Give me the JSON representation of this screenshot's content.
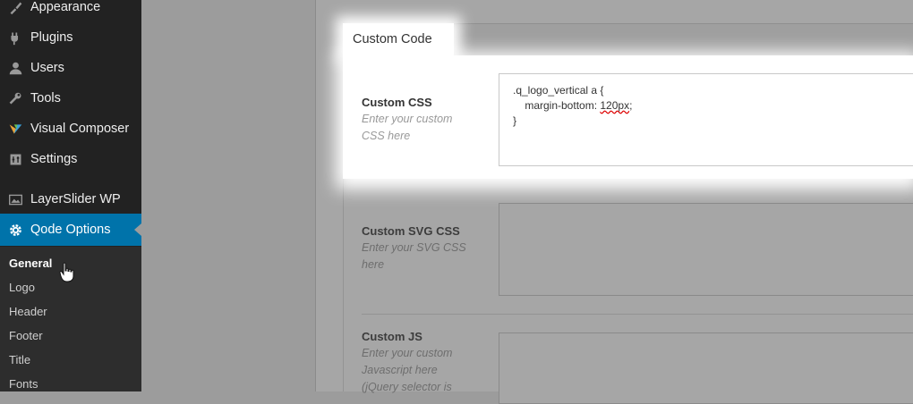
{
  "sidebar": {
    "items": [
      {
        "label": "Appearance",
        "icon": "brush-icon"
      },
      {
        "label": "Plugins",
        "icon": "plug-icon"
      },
      {
        "label": "Users",
        "icon": "user-icon"
      },
      {
        "label": "Tools",
        "icon": "wrench-icon"
      },
      {
        "label": "Visual Composer",
        "icon": "visual-composer-icon"
      },
      {
        "label": "Settings",
        "icon": "settings-icon"
      },
      {
        "label": "LayerSlider WP",
        "icon": "layerslider-icon"
      },
      {
        "label": "Qode Options",
        "icon": "gear-icon"
      }
    ],
    "submenu": [
      "General",
      "Logo",
      "Header",
      "Footer",
      "Title",
      "Fonts"
    ]
  },
  "section": {
    "tab_title": "Custom Code",
    "fields": [
      {
        "label": "Custom CSS",
        "description": "Enter your custom CSS here",
        "desc_lines": [
          "Enter your custom",
          "CSS here"
        ],
        "value_lines": [
          ".q_logo_vertical a {",
          "    margin-bottom: ",
          "120px",
          ";",
          "}"
        ]
      },
      {
        "label": "Custom SVG CSS",
        "description": "Enter your SVG CSS here",
        "desc_lines": [
          "Enter your SVG CSS",
          "here"
        ]
      },
      {
        "label": "Custom JS",
        "description": "Enter your custom Javascript here (jQuery selector is",
        "desc_lines": [
          "Enter your custom",
          "Javascript here",
          "(jQuery selector is"
        ]
      }
    ]
  }
}
